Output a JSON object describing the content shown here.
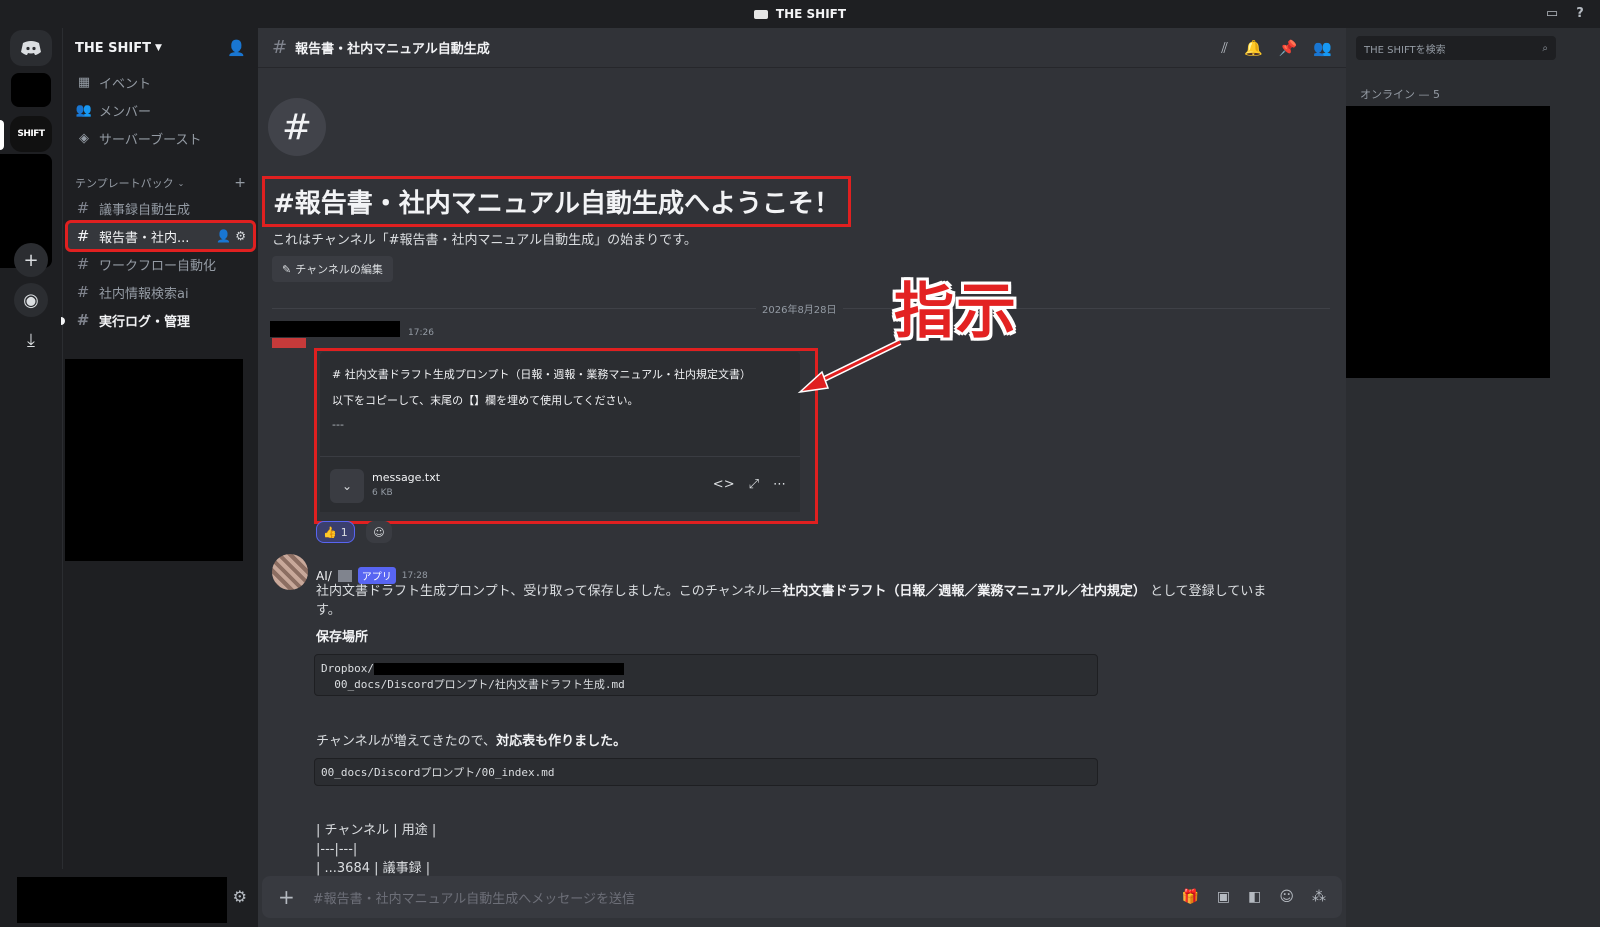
{
  "window": {
    "title": "THE SHIFT"
  },
  "rail": {
    "shift_label": "SHIFT"
  },
  "sidebar": {
    "server_name": "THE SHIFT",
    "nav": [
      {
        "label": "イベント"
      },
      {
        "label": "メンバー"
      },
      {
        "label": "サーバーブースト"
      }
    ],
    "category": "テンプレートパック",
    "channels": [
      {
        "label": "議事録自動生成"
      },
      {
        "label": "報告書・社内..."
      },
      {
        "label": "ワークフロー自動化"
      },
      {
        "label": "社内情報検索ai"
      },
      {
        "label": "実行ログ・管理"
      }
    ]
  },
  "header": {
    "channel_name": "報告書・社内マニュアル自動生成"
  },
  "intro": {
    "title": "#報告書・社内マニュアル自動生成へようこそ！",
    "subtitle": "これはチャンネル「#報告書・社内マニュアル自動生成」の始まりです。",
    "edit_label": "チャンネルの編集"
  },
  "date_divider": "2026年8月28日",
  "message1": {
    "time": "17:26",
    "lines": [
      "# 社内文書ドラフト生成プロンプト（日報・週報・業務マニュアル・社内規定文書）",
      "以下をコピーして、末尾の【】欄を埋めて使用してください。",
      "---"
    ],
    "file": {
      "name": "message.txt",
      "size": "6 KB"
    },
    "reaction_count": "1"
  },
  "annotation": {
    "label": "指示"
  },
  "message2": {
    "author": "AI/",
    "badge": "アプリ",
    "time": "17:28",
    "para1_a": "社内文書ドラフト生成プロンプト、受け取って保存しました。このチャンネル＝",
    "para1_b": "社内文書ドラフト（日報／週報／業務マニュアル／社内規定）",
    "para1_c": " として登録していま",
    "para1_d": "す。",
    "save_heading": "保存場所",
    "code1_line1": "Dropbox/",
    "code1_line2": "  00_docs/Discordプロンプト/社内文書ドラフト生成.md",
    "para2_a": "チャンネルが増えてきたので、",
    "para2_b": "対応表も作りました。",
    "code2": "00_docs/Discordプロンプト/00_index.md",
    "table_lines": [
      "| チャンネル | 用途 |",
      "|---|---|",
      "| ...3684 | 議事録 |"
    ]
  },
  "composer": {
    "placeholder": "#報告書・社内マニュアル自動生成へメッセージを送信"
  },
  "members": {
    "search_placeholder": "THE SHIFTを検索",
    "online_label": "オンライン — 5"
  },
  "colors": {
    "annotation_red": "#e02020",
    "accent": "#5865f2"
  }
}
